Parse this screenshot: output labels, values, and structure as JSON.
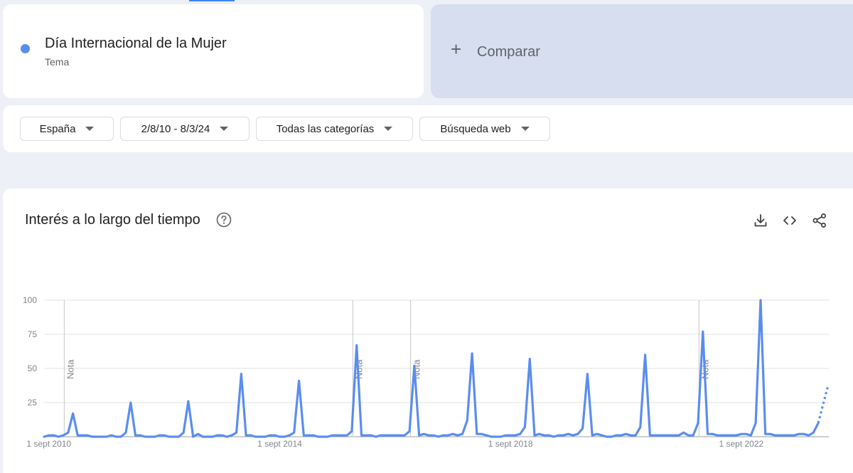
{
  "search_term": {
    "title": "Día Internacional de la Mujer",
    "type": "Tema",
    "color": "#5b8def"
  },
  "compare": {
    "plus": "+",
    "label": "Comparar"
  },
  "filters": {
    "region": "España",
    "date_range": "2/8/10 - 8/3/24",
    "category": "Todas las categorías",
    "search_type": "Búsqueda web"
  },
  "chart_card": {
    "title": "Interés a lo largo del tiempo",
    "icons": [
      "help-icon",
      "download-icon",
      "embed-code-icon",
      "share-icon"
    ]
  },
  "chart_data": {
    "type": "line",
    "title": "",
    "xlabel": "",
    "ylabel": "",
    "ylim": [
      0,
      100
    ],
    "y_ticks": [
      "100",
      "75",
      "50",
      "25"
    ],
    "x_ticks": [
      {
        "label": "1 sept 2010",
        "t": 0.083
      },
      {
        "label": "1 sept 2014",
        "t": 4.083
      },
      {
        "label": "1 sept 2018",
        "t": 8.083
      },
      {
        "label": "1 sept 2022",
        "t": 12.083
      }
    ],
    "annotations": [
      {
        "label": "Nota",
        "t": 0.4
      },
      {
        "label": "Nota",
        "t": 5.4
      },
      {
        "label": "Nota",
        "t": 6.4
      },
      {
        "label": "Nota",
        "t": 11.4
      }
    ],
    "x_start": "2010-08",
    "x_end": "2024-03",
    "line_color": "#5b8def",
    "series": [
      {
        "points": [
          [
            0,
            0
          ],
          [
            0.083,
            1
          ],
          [
            0.167,
            1
          ],
          [
            0.25,
            0
          ],
          [
            0.333,
            1
          ],
          [
            0.417,
            3
          ],
          [
            0.5,
            17
          ],
          [
            0.583,
            1
          ],
          [
            0.667,
            1
          ],
          [
            0.75,
            1
          ],
          [
            0.833,
            0
          ],
          [
            0.917,
            0
          ],
          [
            1.0,
            0
          ],
          [
            1.083,
            0
          ],
          [
            1.167,
            1
          ],
          [
            1.25,
            0
          ],
          [
            1.333,
            0
          ],
          [
            1.417,
            3
          ],
          [
            1.5,
            25
          ],
          [
            1.583,
            1
          ],
          [
            1.667,
            1
          ],
          [
            1.75,
            0
          ],
          [
            1.833,
            0
          ],
          [
            1.917,
            0
          ],
          [
            2.0,
            1
          ],
          [
            2.083,
            1
          ],
          [
            2.167,
            0
          ],
          [
            2.25,
            0
          ],
          [
            2.333,
            0
          ],
          [
            2.417,
            3
          ],
          [
            2.5,
            26
          ],
          [
            2.583,
            0
          ],
          [
            2.667,
            2
          ],
          [
            2.75,
            0
          ],
          [
            2.833,
            0
          ],
          [
            2.917,
            0
          ],
          [
            3.0,
            1
          ],
          [
            3.083,
            1
          ],
          [
            3.167,
            0
          ],
          [
            3.25,
            1
          ],
          [
            3.333,
            3
          ],
          [
            3.417,
            46
          ],
          [
            3.5,
            1
          ],
          [
            3.583,
            1
          ],
          [
            3.667,
            0
          ],
          [
            3.75,
            0
          ],
          [
            3.833,
            0
          ],
          [
            3.917,
            1
          ],
          [
            4.0,
            1
          ],
          [
            4.083,
            0
          ],
          [
            4.167,
            0
          ],
          [
            4.25,
            1
          ],
          [
            4.333,
            3
          ],
          [
            4.417,
            41
          ],
          [
            4.5,
            1
          ],
          [
            4.583,
            1
          ],
          [
            4.667,
            1
          ],
          [
            4.75,
            0
          ],
          [
            4.833,
            0
          ],
          [
            4.917,
            0
          ],
          [
            5.0,
            1
          ],
          [
            5.083,
            1
          ],
          [
            5.167,
            1
          ],
          [
            5.25,
            1
          ],
          [
            5.333,
            4
          ],
          [
            5.417,
            67
          ],
          [
            5.5,
            1
          ],
          [
            5.583,
            1
          ],
          [
            5.667,
            1
          ],
          [
            5.75,
            0
          ],
          [
            5.833,
            1
          ],
          [
            5.917,
            1
          ],
          [
            6.0,
            1
          ],
          [
            6.083,
            1
          ],
          [
            6.167,
            1
          ],
          [
            6.25,
            1
          ],
          [
            6.333,
            4
          ],
          [
            6.417,
            52
          ],
          [
            6.5,
            1
          ],
          [
            6.583,
            2
          ],
          [
            6.667,
            1
          ],
          [
            6.75,
            1
          ],
          [
            6.833,
            0
          ],
          [
            6.917,
            1
          ],
          [
            7.0,
            1
          ],
          [
            7.083,
            2
          ],
          [
            7.167,
            1
          ],
          [
            7.25,
            2
          ],
          [
            7.333,
            12
          ],
          [
            7.417,
            61
          ],
          [
            7.5,
            2
          ],
          [
            7.583,
            2
          ],
          [
            7.667,
            1
          ],
          [
            7.75,
            0
          ],
          [
            7.833,
            0
          ],
          [
            7.917,
            0
          ],
          [
            8.0,
            1
          ],
          [
            8.083,
            1
          ],
          [
            8.167,
            1
          ],
          [
            8.25,
            2
          ],
          [
            8.333,
            7
          ],
          [
            8.417,
            57
          ],
          [
            8.5,
            1
          ],
          [
            8.583,
            2
          ],
          [
            8.667,
            1
          ],
          [
            8.75,
            1
          ],
          [
            8.833,
            0
          ],
          [
            8.917,
            1
          ],
          [
            9.0,
            1
          ],
          [
            9.083,
            2
          ],
          [
            9.167,
            1
          ],
          [
            9.25,
            2
          ],
          [
            9.333,
            6
          ],
          [
            9.417,
            46
          ],
          [
            9.5,
            1
          ],
          [
            9.583,
            2
          ],
          [
            9.667,
            1
          ],
          [
            9.75,
            0
          ],
          [
            9.833,
            0
          ],
          [
            9.917,
            1
          ],
          [
            10.0,
            1
          ],
          [
            10.083,
            2
          ],
          [
            10.167,
            1
          ],
          [
            10.25,
            1
          ],
          [
            10.333,
            7
          ],
          [
            10.417,
            60
          ],
          [
            10.5,
            1
          ],
          [
            10.583,
            1
          ],
          [
            10.667,
            1
          ],
          [
            10.75,
            1
          ],
          [
            10.833,
            1
          ],
          [
            10.917,
            1
          ],
          [
            11.0,
            1
          ],
          [
            11.083,
            3
          ],
          [
            11.167,
            1
          ],
          [
            11.25,
            1
          ],
          [
            11.333,
            10
          ],
          [
            11.417,
            77
          ],
          [
            11.5,
            2
          ],
          [
            11.583,
            2
          ],
          [
            11.667,
            1
          ],
          [
            11.75,
            1
          ],
          [
            11.833,
            1
          ],
          [
            11.917,
            1
          ],
          [
            12.0,
            1
          ],
          [
            12.083,
            2
          ],
          [
            12.167,
            2
          ],
          [
            12.25,
            1
          ],
          [
            12.333,
            10
          ],
          [
            12.417,
            100
          ],
          [
            12.5,
            2
          ],
          [
            12.583,
            2
          ],
          [
            12.667,
            1
          ],
          [
            12.75,
            1
          ],
          [
            12.833,
            1
          ],
          [
            12.917,
            1
          ],
          [
            13.0,
            1
          ],
          [
            13.083,
            2
          ],
          [
            13.167,
            2
          ],
          [
            13.25,
            1
          ],
          [
            13.333,
            3
          ],
          [
            13.417,
            10
          ]
        ],
        "partial_points": [
          [
            13.417,
            10
          ],
          [
            13.583,
            37
          ]
        ]
      }
    ]
  }
}
